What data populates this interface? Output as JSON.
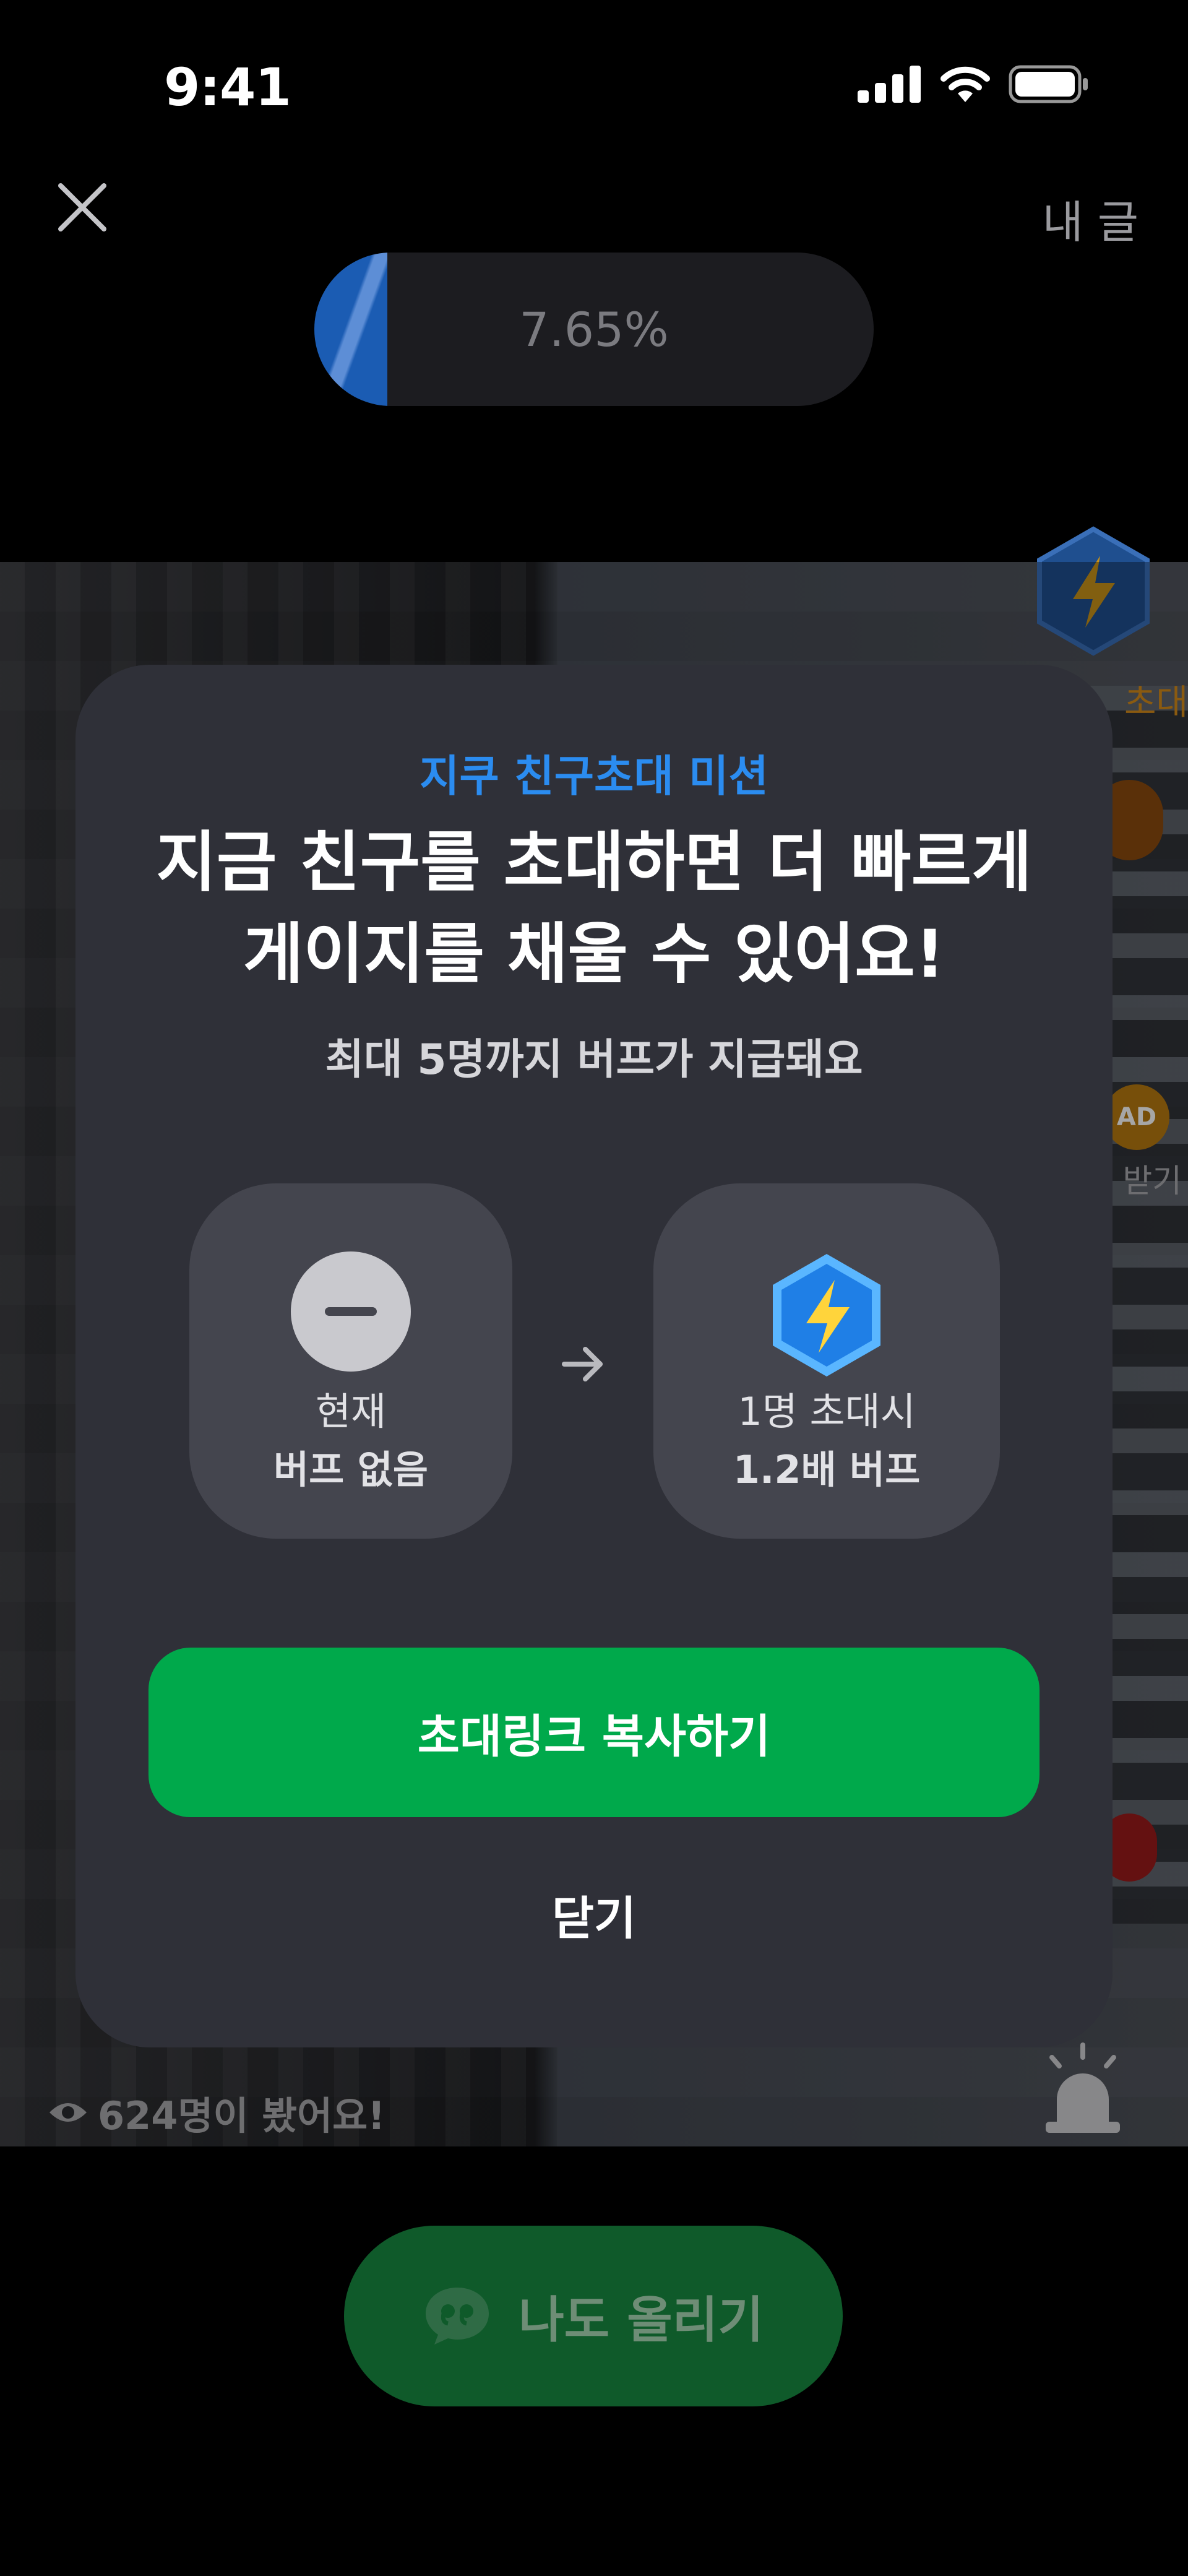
{
  "status_bar": {
    "time": "9:41"
  },
  "header": {
    "my_post_label": "내 글"
  },
  "progress": {
    "value_percent": 7.65,
    "label": "7.65%"
  },
  "background": {
    "side_label_1": "초대",
    "ad_badge": "AD",
    "side_label_2": "받기",
    "view_count": "624명이 봤어요!"
  },
  "modal": {
    "eyebrow": "지쿠 친구초대 미션",
    "title_line1": "지금 친구를 초대하면 더 빠르게",
    "title_line2": "게이지를 채울 수 있어요!",
    "subtitle": "최대 5명까지 버프가 지급돼요",
    "current_card": {
      "line1": "현재",
      "line2": "버프 없음"
    },
    "buff_card": {
      "line1": "1명 초대시",
      "line2": "1.2배 버프"
    },
    "copy_button": "초대링크 복사하기",
    "close_button": "닫기"
  },
  "bottom": {
    "me_too_button": "나도 올리기"
  },
  "colors": {
    "accent_blue": "#2b8cf0",
    "primary_green": "#00a94b",
    "modal_bg": "#2f3038",
    "card_bg": "#44454e"
  }
}
